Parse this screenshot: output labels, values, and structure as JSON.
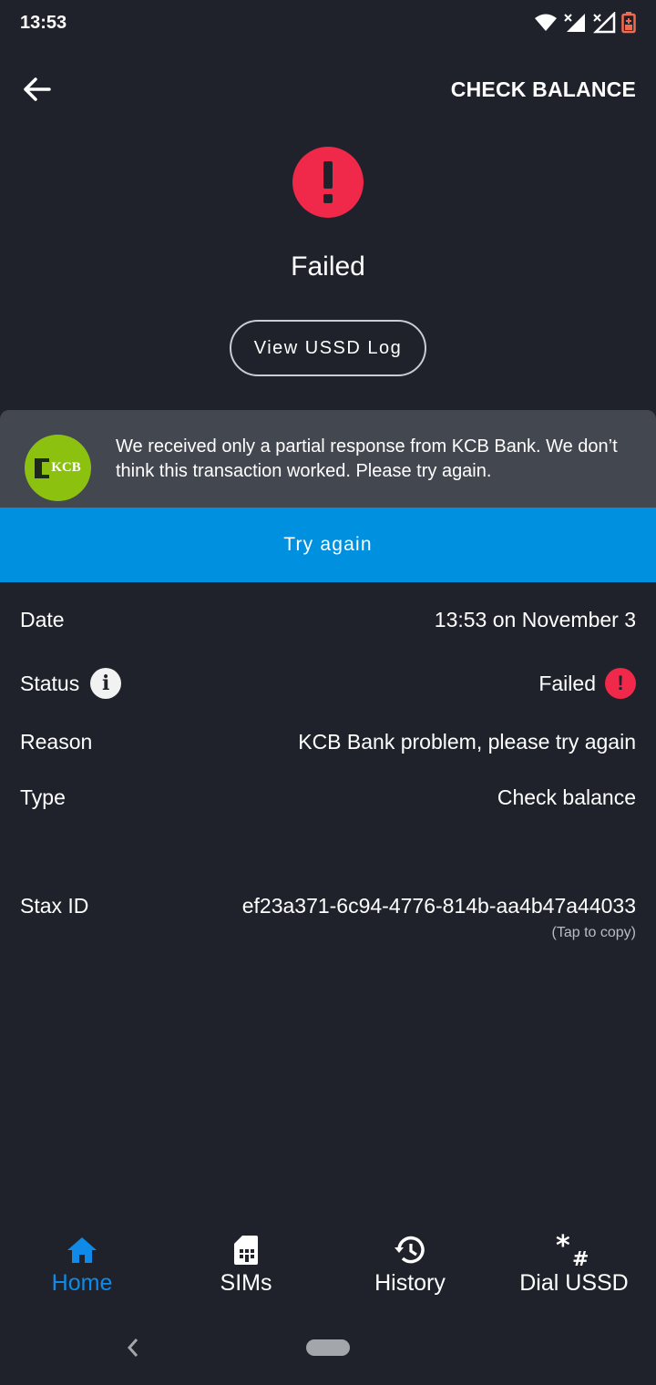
{
  "status_bar": {
    "time": "13:53"
  },
  "app_bar": {
    "action": "CHECK BALANCE"
  },
  "result": {
    "title": "Failed",
    "log_button": "View USSD Log"
  },
  "message": {
    "logo_text": "KCB",
    "text": "We received only a partial response from KCB Bank. We don’t think this transaction worked. Please try again."
  },
  "retry_button": "Try again",
  "details": {
    "date_label": "Date",
    "date_value": "13:53 on November 3",
    "status_label": "Status",
    "status_value": "Failed",
    "reason_label": "Reason",
    "reason_value": "KCB Bank problem, please try again",
    "type_label": "Type",
    "type_value": "Check balance",
    "stax_label": "Stax ID",
    "stax_value": "ef23a371-6c94-4776-814b-aa4b47a44033",
    "tap_copy": "(Tap to copy)"
  },
  "bottom_nav": {
    "home": "Home",
    "sims": "SIMs",
    "history": "History",
    "dial": "Dial USSD"
  },
  "colors": {
    "accent": "#0090e0",
    "error": "#f0284a",
    "background": "#1f222a",
    "active_nav": "#0f8ae8"
  }
}
